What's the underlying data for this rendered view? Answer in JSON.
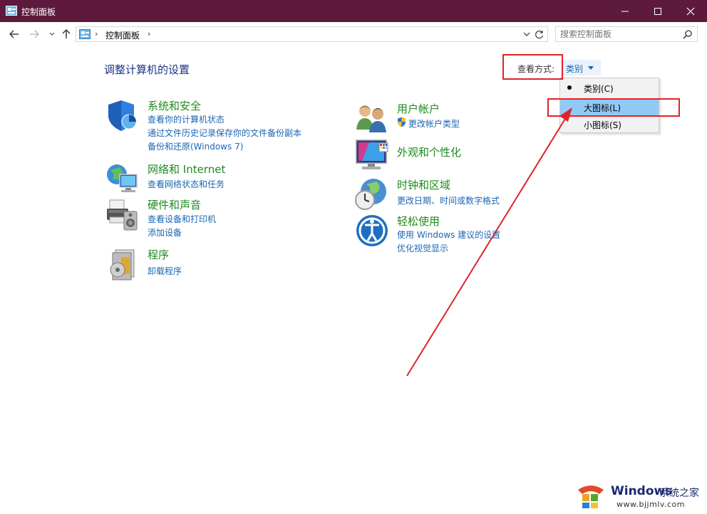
{
  "window": {
    "title": "控制面板"
  },
  "address": {
    "crumb": "控制面板",
    "separator": "›"
  },
  "search": {
    "placeholder": "搜索控制面板"
  },
  "main": {
    "heading": "调整计算机的设置",
    "view_by_label": "查看方式:",
    "view_by_value": "类别"
  },
  "menu": {
    "items": [
      {
        "label": "类别(C)",
        "selected": true
      },
      {
        "label": "大图标(L)",
        "selected": false
      },
      {
        "label": "小图标(S)",
        "selected": false
      }
    ]
  },
  "categories": {
    "left": [
      {
        "title": "系统和安全",
        "icon": "shield-icon",
        "links": [
          "查看你的计算机状态",
          "通过文件历史记录保存你的文件备份副本",
          "备份和还原(Windows 7)"
        ]
      },
      {
        "title": "网络和 Internet",
        "icon": "network-icon",
        "links": [
          "查看网络状态和任务"
        ]
      },
      {
        "title": "硬件和声音",
        "icon": "printer-icon",
        "links": [
          "查看设备和打印机",
          "添加设备"
        ]
      },
      {
        "title": "程序",
        "icon": "programs-icon",
        "links": [
          "卸载程序"
        ]
      }
    ],
    "right": [
      {
        "title": "用户帐户",
        "icon": "users-icon",
        "links": [
          "更改帐户类型"
        ]
      },
      {
        "title": "外观和个性化",
        "icon": "monitor-icon",
        "links": []
      },
      {
        "title": "时钟和区域",
        "icon": "clock-globe-icon",
        "links": [
          "更改日期、时间或数字格式"
        ]
      },
      {
        "title": "轻松使用",
        "icon": "ease-of-access-icon",
        "links": [
          "使用 Windows 建议的设置",
          "优化视觉显示"
        ]
      }
    ]
  },
  "watermark": {
    "brand": "Windows",
    "suffix": "系统之家",
    "url": "www.bjjmlv.com"
  },
  "colors": {
    "titlebar": "#5e1a3c",
    "category_title": "#1e8a1e",
    "link": "#1a66b3",
    "heading": "#1e3287",
    "highlight_box": "#e0222a",
    "menu_highlight": "#91c9f7"
  }
}
